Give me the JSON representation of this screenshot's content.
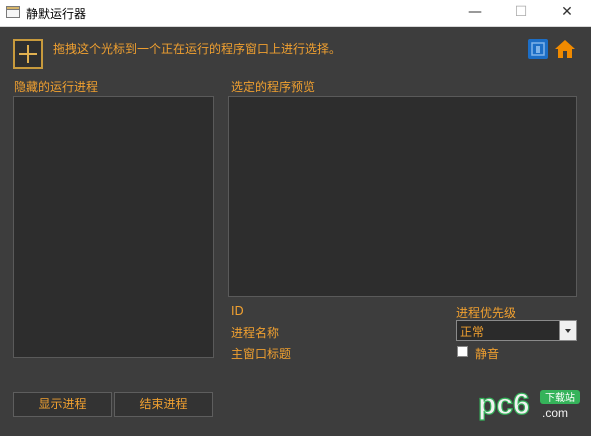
{
  "window": {
    "title": "静默运行器",
    "controls": {
      "minimize": "—",
      "maximize": "☐",
      "close": "✕"
    }
  },
  "toolbar": {
    "instruction": "拖拽这个光标到一个正在运行的程序窗口上进行选择。",
    "crosshair_icon": "crosshair-icon",
    "info_icon": "info-icon",
    "home_icon": "home-icon"
  },
  "left_panel": {
    "label": "隐藏的运行进程",
    "items": []
  },
  "right_panel": {
    "preview_label": "选定的程序预览",
    "fields": {
      "id": "ID",
      "process_name": "进程名称",
      "main_window_title": "主窗口标题"
    },
    "priority": {
      "label": "进程优先级",
      "selected": "正常"
    },
    "mute": {
      "label": "静音",
      "checked": false
    }
  },
  "buttons": {
    "show_process": "显示进程",
    "end_process": "结束进程"
  },
  "watermark": {
    "brand": "pc6",
    "tag": "下载站",
    "domain": ".com"
  },
  "colors": {
    "accent": "#f0a030",
    "background": "#3d3d3d",
    "panel": "#2d2d2d",
    "info_blue": "#1c6ec6",
    "home_orange": "#f08a00",
    "watermark_green": "#35b35a"
  }
}
